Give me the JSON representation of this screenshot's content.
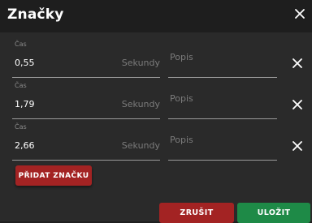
{
  "dialog": {
    "title": "Značky",
    "close_icon": "close-icon"
  },
  "marks": [
    {
      "time_label": "Čas",
      "time_value": "0,55",
      "unit": "Sekundy",
      "description_placeholder": "Popis",
      "remove_icon": "close-icon"
    },
    {
      "time_label": "Čas",
      "time_value": "1,79",
      "unit": "Sekundy",
      "description_placeholder": "Popis",
      "remove_icon": "close-icon"
    },
    {
      "time_label": "Čas",
      "time_value": "2,66",
      "unit": "Sekundy",
      "description_placeholder": "Popis",
      "remove_icon": "close-icon"
    }
  ],
  "actions": {
    "add_mark_label": "PŘIDAT ZNAČKU",
    "cancel_label": "ZRUŠIT",
    "save_label": "ULOŽIT"
  },
  "colors": {
    "title_bar": "#1e1e1e",
    "content_bg": "#2a2a2a",
    "danger": "#a32323",
    "success": "#1e8a47",
    "placeholder": "#7b7b7b"
  }
}
